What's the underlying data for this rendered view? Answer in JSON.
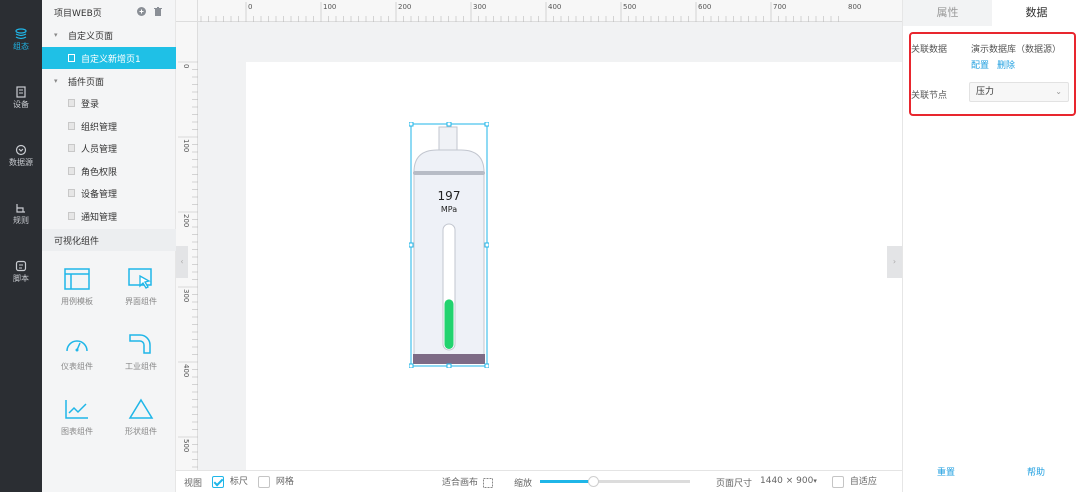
{
  "nav": {
    "items": [
      {
        "label": "组态",
        "icon": "layers-icon",
        "active": true
      },
      {
        "label": "设备",
        "icon": "device-icon",
        "active": false
      },
      {
        "label": "数据源",
        "icon": "datasource-icon",
        "active": false
      },
      {
        "label": "规则",
        "icon": "rule-icon",
        "active": false
      },
      {
        "label": "脚本",
        "icon": "script-icon",
        "active": false
      }
    ]
  },
  "tree": {
    "project_title": "项目WEB页",
    "custom_group": "自定义页面",
    "custom_pages": [
      "自定义新增页1"
    ],
    "plugin_group": "插件页面",
    "plugin_pages": [
      "登录",
      "组织管理",
      "人员管理",
      "角色权限",
      "设备管理",
      "通知管理"
    ],
    "components_title": "可视化组件",
    "components": [
      "用例模板",
      "界面组件",
      "仪表组件",
      "工业组件",
      "图表组件",
      "形状组件"
    ]
  },
  "ruler": {
    "top_ticks": [
      "0",
      "100",
      "200",
      "300",
      "400",
      "500",
      "600",
      "700",
      "800"
    ],
    "left_ticks": [
      "0",
      "100",
      "200",
      "300",
      "400",
      "500"
    ]
  },
  "gauge": {
    "value": "197",
    "unit": "MPa",
    "level_fraction": 0.4,
    "fill_color": "#22d36f",
    "base_color": "#7d6b86"
  },
  "status": {
    "view_label": "视图",
    "ruler_label": "标尺",
    "ruler_checked": true,
    "grid_label": "网格",
    "grid_checked": false,
    "fit_label": "适合画布",
    "zoom_label": "缩放",
    "zoom_fraction": 0.35,
    "page_size_label": "页面尺寸",
    "page_size_value": "1440 × 900",
    "adaptive_label": "自适应"
  },
  "panel": {
    "tab_properties": "属性",
    "tab_data": "数据",
    "related_data_label": "关联数据",
    "related_data_value": "演示数据库（数据源）",
    "config_link": "配置",
    "delete_link": "删除",
    "related_node_label": "关联节点",
    "related_node_value": "压力",
    "reset_label": "重置",
    "help_label": "帮助"
  },
  "colors": {
    "accent": "#1fb6e8",
    "highlight": "#e8262e",
    "nav_bg": "#2b2e33"
  }
}
